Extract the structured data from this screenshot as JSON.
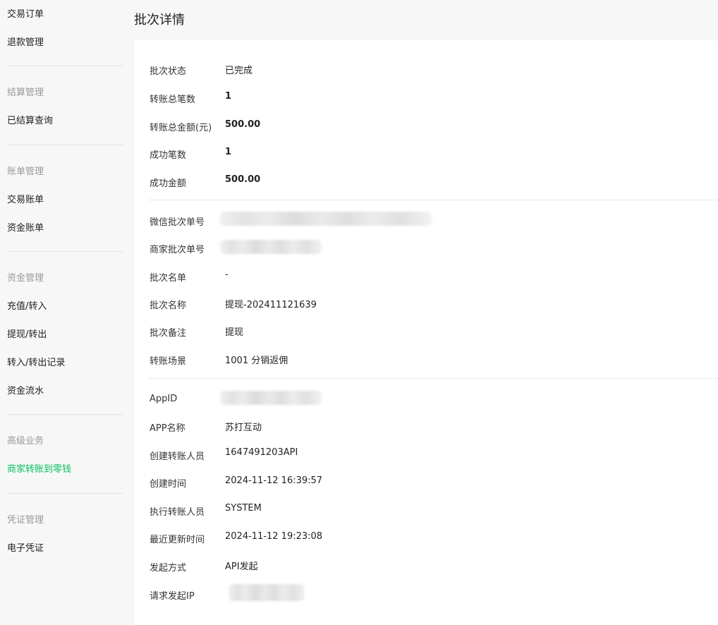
{
  "sidebar": {
    "items_top": [
      {
        "label": "交易订单"
      },
      {
        "label": "退款管理"
      }
    ],
    "groups": [
      {
        "title": "结算管理",
        "items": [
          {
            "label": "已结算查询"
          }
        ]
      },
      {
        "title": "账单管理",
        "items": [
          {
            "label": "交易账单"
          },
          {
            "label": "资金账单"
          }
        ]
      },
      {
        "title": "资金管理",
        "items": [
          {
            "label": "充值/转入"
          },
          {
            "label": "提现/转出"
          },
          {
            "label": "转入/转出记录"
          },
          {
            "label": "资金流水"
          }
        ]
      },
      {
        "title": "高级业务",
        "items": [
          {
            "label": "商家转账到零钱",
            "active": true
          }
        ]
      },
      {
        "title": "凭证管理",
        "items": [
          {
            "label": "电子凭证"
          }
        ]
      }
    ],
    "active_color": "#07c160"
  },
  "page": {
    "title": "批次详情"
  },
  "details": {
    "batch_status": {
      "label": "批次状态",
      "value": "已完成"
    },
    "total_count": {
      "label": "转账总笔数",
      "value": "1"
    },
    "total_amount": {
      "label": "转账总金额(元)",
      "value": "500.00"
    },
    "success_count": {
      "label": "成功笔数",
      "value": "1"
    },
    "success_amount": {
      "label": "成功金额",
      "value": "500.00"
    },
    "wechat_batch_no": {
      "label": "微信批次单号",
      "value": ""
    },
    "merchant_batch_no": {
      "label": "商家批次单号",
      "value": ""
    },
    "batch_list": {
      "label": "批次名单",
      "value": "-"
    },
    "batch_name": {
      "label": "批次名称",
      "value": "提现-202411121639"
    },
    "batch_remark": {
      "label": "批次备注",
      "value": "提现"
    },
    "transfer_scene": {
      "label": "转账场景",
      "value": "1001 分销返佣"
    },
    "appid": {
      "label": "AppID",
      "value": ""
    },
    "app_name": {
      "label": "APP名称",
      "value": "苏打互动"
    },
    "creator": {
      "label": "创建转账人员",
      "value": "1647491203API"
    },
    "create_time": {
      "label": "创建时间",
      "value": "2024-11-12 16:39:57"
    },
    "executor": {
      "label": "执行转账人员",
      "value": "SYSTEM"
    },
    "update_time": {
      "label": "最近更新时间",
      "value": "2024-11-12 19:23:08"
    },
    "initiation": {
      "label": "发起方式",
      "value": "API发起"
    },
    "request_ip": {
      "label": "请求发起IP",
      "value": ""
    }
  }
}
